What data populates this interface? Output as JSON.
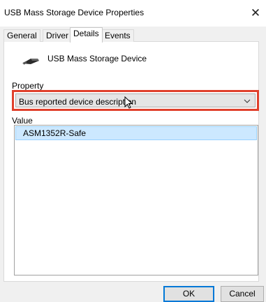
{
  "window": {
    "title": "USB Mass Storage Device Properties",
    "close_glyph": "✕"
  },
  "tabs": [
    {
      "label": "General",
      "active": false
    },
    {
      "label": "Driver",
      "active": false
    },
    {
      "label": "Details",
      "active": true
    },
    {
      "label": "Events",
      "active": false
    }
  ],
  "device": {
    "name": "USB Mass Storage Device",
    "icon": "usb-drive-icon"
  },
  "property": {
    "label": "Property",
    "selected": "Bus reported device description",
    "highlight_color": "#e0402c"
  },
  "value": {
    "label": "Value",
    "items": [
      "ASM1352R-Safe"
    ],
    "selection_color": "#cce8ff"
  },
  "buttons": {
    "ok": "OK",
    "cancel": "Cancel"
  }
}
